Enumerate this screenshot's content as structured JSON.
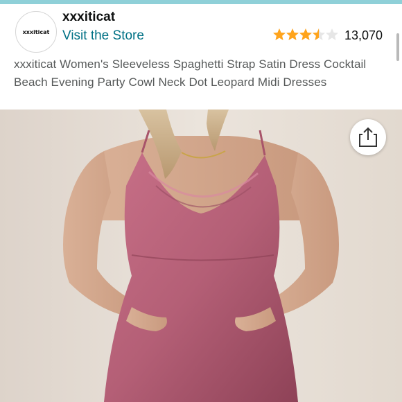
{
  "store": {
    "logo_text": "xxxiticat",
    "name": "xxxiticat",
    "visit_label": "Visit the Store"
  },
  "rating": {
    "stars": 3.5,
    "max_stars": 5,
    "count": "13,070",
    "star_color": "#ffa41c"
  },
  "product": {
    "title": "xxxiticat Women's Sleeveless Spaghetti Strap Satin Dress Cocktail Beach Evening Party Cowl Neck Dot Leopard Midi Dresses",
    "image_subject": "model wearing pink satin cowl neck slip dress"
  },
  "icons": {
    "share": "share-icon"
  },
  "colors": {
    "link": "#007185",
    "dress": "#b45f76",
    "background": "#e7dfd7"
  }
}
